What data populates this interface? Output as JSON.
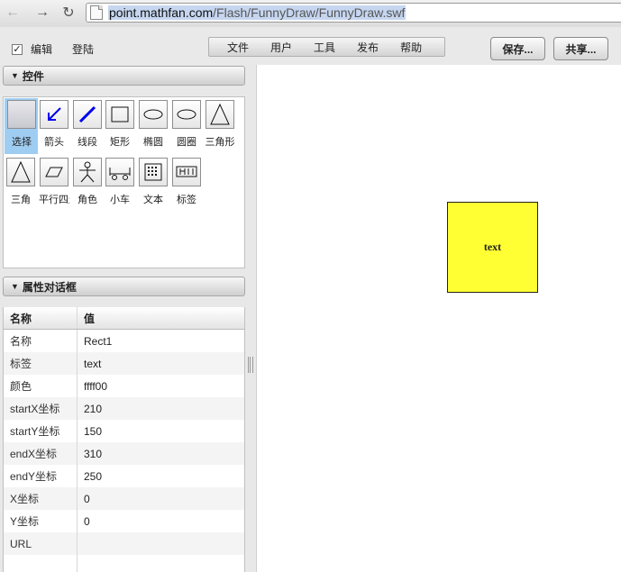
{
  "browser": {
    "url_host": "point.mathfan.com",
    "url_path": "/Flash/FunnyDraw/FunnyDraw.swf"
  },
  "toolbar": {
    "edit_checked": true,
    "edit_label": "编辑",
    "login_label": "登陆",
    "menu": [
      "文件",
      "用户",
      "工具",
      "发布",
      "帮助"
    ],
    "save_label": "保存...",
    "share_label": "共享..."
  },
  "controls_panel": {
    "title": "控件",
    "tools": [
      {
        "label": "选择",
        "icon": "select-icon",
        "selected": true
      },
      {
        "label": "箭头",
        "icon": "arrow-icon"
      },
      {
        "label": "线段",
        "icon": "line-segment-icon"
      },
      {
        "label": "矩形",
        "icon": "rectangle-icon"
      },
      {
        "label": "椭圆",
        "icon": "ellipse-icon"
      },
      {
        "label": "圆圈",
        "icon": "circle-icon"
      },
      {
        "label": "三角形",
        "icon": "triangle-icon"
      },
      {
        "label": "三角",
        "icon": "triangle-outline-icon"
      },
      {
        "label": "平行四边形",
        "icon": "parallelogram-icon"
      },
      {
        "label": "角色",
        "icon": "stick-figure-icon"
      },
      {
        "label": "小车",
        "icon": "cart-icon"
      },
      {
        "label": "文本",
        "icon": "text-grid-icon"
      },
      {
        "label": "标签",
        "icon": "label-tag-icon"
      }
    ]
  },
  "properties_panel": {
    "title": "属性对话框",
    "col_name": "名称",
    "col_value": "值",
    "rows": [
      {
        "name": "名称",
        "value": "Rect1"
      },
      {
        "name": "标签",
        "value": "text"
      },
      {
        "name": "颜色",
        "value": "ffff00"
      },
      {
        "name": "startX坐标",
        "value": "210"
      },
      {
        "name": "startY坐标",
        "value": "150"
      },
      {
        "name": "endX坐标",
        "value": "310"
      },
      {
        "name": "endY坐标",
        "value": "250"
      },
      {
        "name": "X坐标",
        "value": "0"
      },
      {
        "name": "Y坐标",
        "value": "0"
      },
      {
        "name": "URL",
        "value": ""
      }
    ]
  },
  "canvas": {
    "rect_label": "text",
    "rect_color": "#ffff33"
  }
}
